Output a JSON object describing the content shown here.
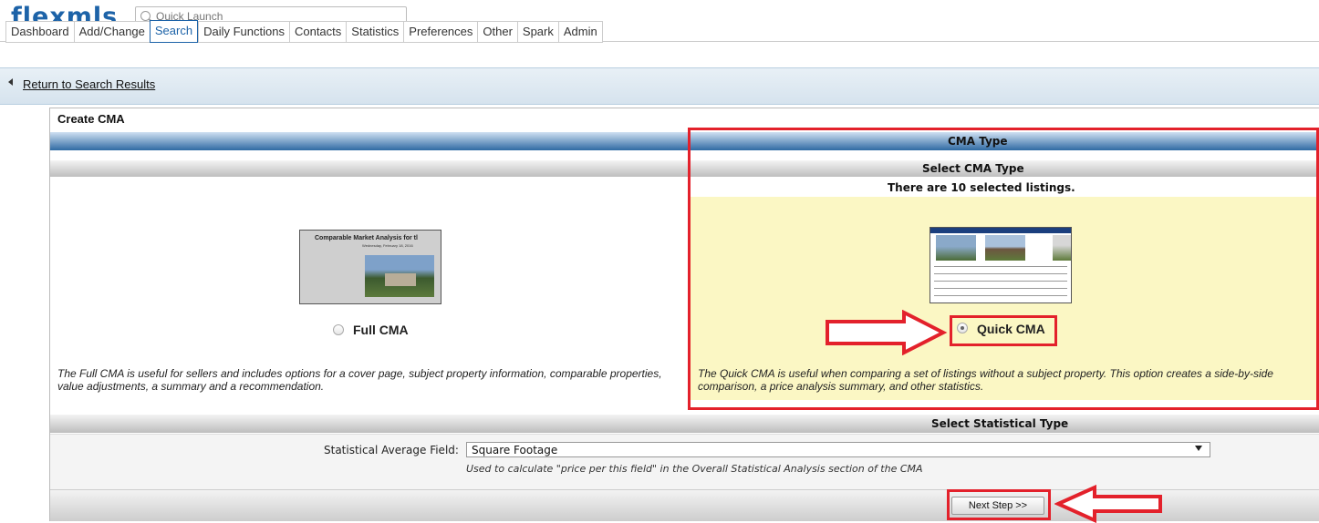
{
  "app": {
    "logo": "flexmls"
  },
  "quick_launch": {
    "placeholder": "Quick Launch"
  },
  "nav": {
    "tabs": [
      {
        "label": "Dashboard"
      },
      {
        "label": "Add/Change"
      },
      {
        "label": "Search",
        "active": true
      },
      {
        "label": "Daily Functions"
      },
      {
        "label": "Contacts"
      },
      {
        "label": "Statistics"
      },
      {
        "label": "Preferences"
      },
      {
        "label": "Other"
      },
      {
        "label": "Spark"
      },
      {
        "label": "Admin"
      }
    ]
  },
  "return_link": "Return to Search Results",
  "panel": {
    "title": "Create CMA",
    "cma_type_header": "CMA Type",
    "select_cma_type_header": "Select CMA Type",
    "selected_listings_text": "There are 10 selected listings.",
    "options": {
      "full": {
        "label": "Full CMA",
        "checked": false,
        "thumb_title": "Comparable Market Analysis for tl",
        "thumb_subtitle": "Wednesday, February 18, 2016",
        "description": "The Full CMA is useful for sellers and includes options for a cover page, subject property information, comparable properties, value adjustments, a summary and a recommendation."
      },
      "quick": {
        "label": "Quick CMA",
        "checked": true,
        "description": "The Quick CMA is useful when comparing a set of listings without a subject property. This option creates a side-by-side comparison, a price analysis summary, and other statistics."
      }
    },
    "select_stat_type_header": "Select Statistical Type",
    "stat_field": {
      "label": "Statistical Average Field:",
      "value": "Square Footage",
      "help": "Used to calculate \"price per this field\" in the Overall Statistical Analysis section of the CMA"
    },
    "next_button": "Next Step >>"
  },
  "colors": {
    "brand_blue": "#1d63a8",
    "highlight_yellow": "#fbf7c4",
    "annotation_red": "#e3212b"
  }
}
